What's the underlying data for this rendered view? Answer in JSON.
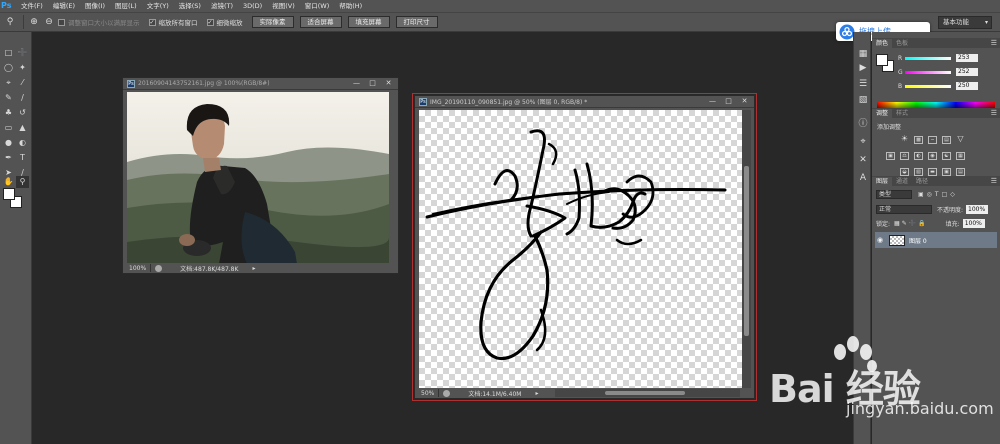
{
  "app": {
    "logo": "Ps"
  },
  "menu": [
    "文件(F)",
    "编辑(E)",
    "图像(I)",
    "图层(L)",
    "文字(Y)",
    "选择(S)",
    "滤镜(T)",
    "3D(D)",
    "视图(V)",
    "窗口(W)",
    "帮助(H)"
  ],
  "options": {
    "resize_windows_label": "调整窗口大小以满屏显示",
    "zoom_all_windows_label": "缩放所有窗口",
    "scrubby_zoom_label": "细微缩放",
    "actual_pixels_label": "实际像素",
    "fit_screen_label": "适合屏幕",
    "fill_screen_label": "填充屏幕",
    "print_size_label": "打印尺寸",
    "workspace": "基本功能"
  },
  "upload_badge": {
    "label": "拖拽上传"
  },
  "doc1": {
    "title": "20160904143752161.jpg @ 100%(RGB/8#)",
    "zoom": "100%",
    "status": "文档:487.8K/487.8K"
  },
  "doc2": {
    "title": "IMG_20190110_090851.jpg @ 50% (图层 0, RGB/8) *",
    "zoom": "50%",
    "status": "文档:14.1M/6.40M"
  },
  "color_panel": {
    "tabs": [
      "颜色",
      "色板"
    ],
    "r": "253",
    "g": "252",
    "b": "250",
    "r_label": "R",
    "g_label": "G",
    "b_label": "B"
  },
  "adjust_panel": {
    "tabs": [
      "调整",
      "样式"
    ],
    "title": "添加调整"
  },
  "layers_panel": {
    "tabs": [
      "图层",
      "通道",
      "路径"
    ],
    "kind_filter": "类型",
    "blend_mode": "正常",
    "opacity_label": "不透明度:",
    "opacity": "100%",
    "lock_label": "锁定:",
    "fill_label": "填充:",
    "fill": "100%",
    "layers": [
      {
        "name": "图层 0"
      }
    ]
  },
  "watermark": {
    "brand": "Bai  经验",
    "url": "jingyan.baidu.com"
  },
  "colors": {
    "accent": "#31a8ff",
    "selection_outline": "#b03030"
  }
}
